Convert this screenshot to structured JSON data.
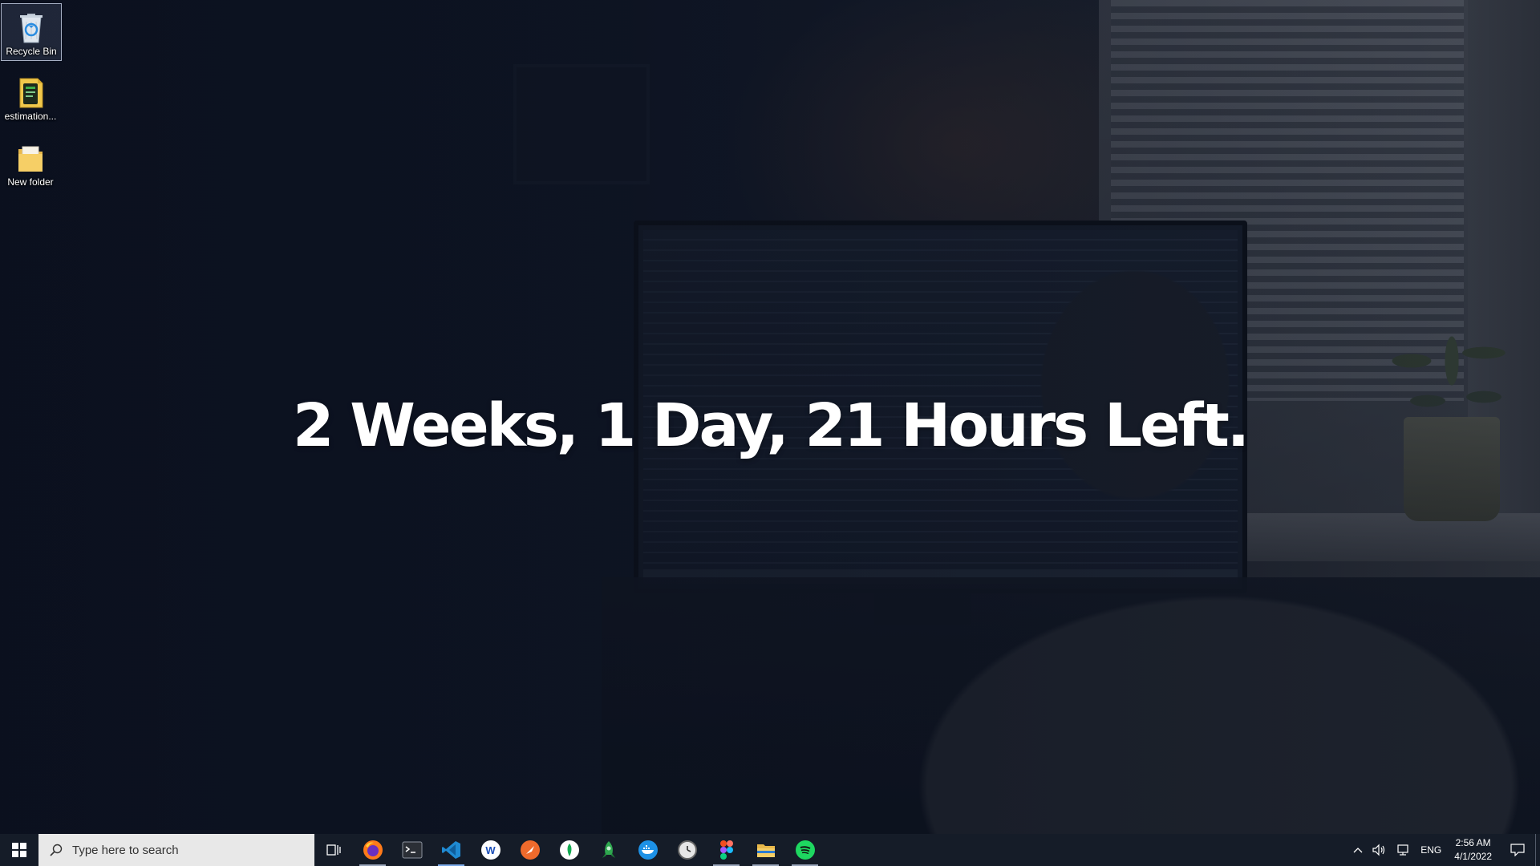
{
  "countdown": {
    "text": "2 Weeks, 1 Day, 21 Hours Left."
  },
  "desktop": {
    "icons": [
      {
        "label": "Recycle Bin",
        "icon": "recycle-bin-icon"
      },
      {
        "label": "estimation...",
        "icon": "file-icon"
      },
      {
        "label": "New folder",
        "icon": "folder-icon"
      }
    ]
  },
  "taskbar": {
    "search_placeholder": "Type here to search",
    "pinned_apps": [
      {
        "name": "firefox",
        "icon": "firefox-icon"
      },
      {
        "name": "terminal",
        "icon": "terminal-icon"
      },
      {
        "name": "vscode",
        "icon": "vscode-icon"
      },
      {
        "name": "app-w",
        "icon": "w-icon"
      },
      {
        "name": "postman",
        "icon": "postman-icon"
      },
      {
        "name": "mongodb",
        "icon": "mongodb-icon"
      },
      {
        "name": "rocket",
        "icon": "rocket-icon"
      },
      {
        "name": "docker",
        "icon": "docker-icon"
      },
      {
        "name": "clock-app",
        "icon": "clock-app-icon"
      },
      {
        "name": "figma",
        "icon": "figma-icon"
      },
      {
        "name": "file-explorer",
        "icon": "folder-icon"
      },
      {
        "name": "spotify",
        "icon": "spotify-icon"
      }
    ],
    "tray": {
      "language": "ENG",
      "time": "2:56 AM",
      "date": "4/1/2022"
    }
  },
  "colors": {
    "taskbar_bg": "#151c28",
    "accent": "#7aa9e8",
    "countdown_text": "#ffffff"
  }
}
